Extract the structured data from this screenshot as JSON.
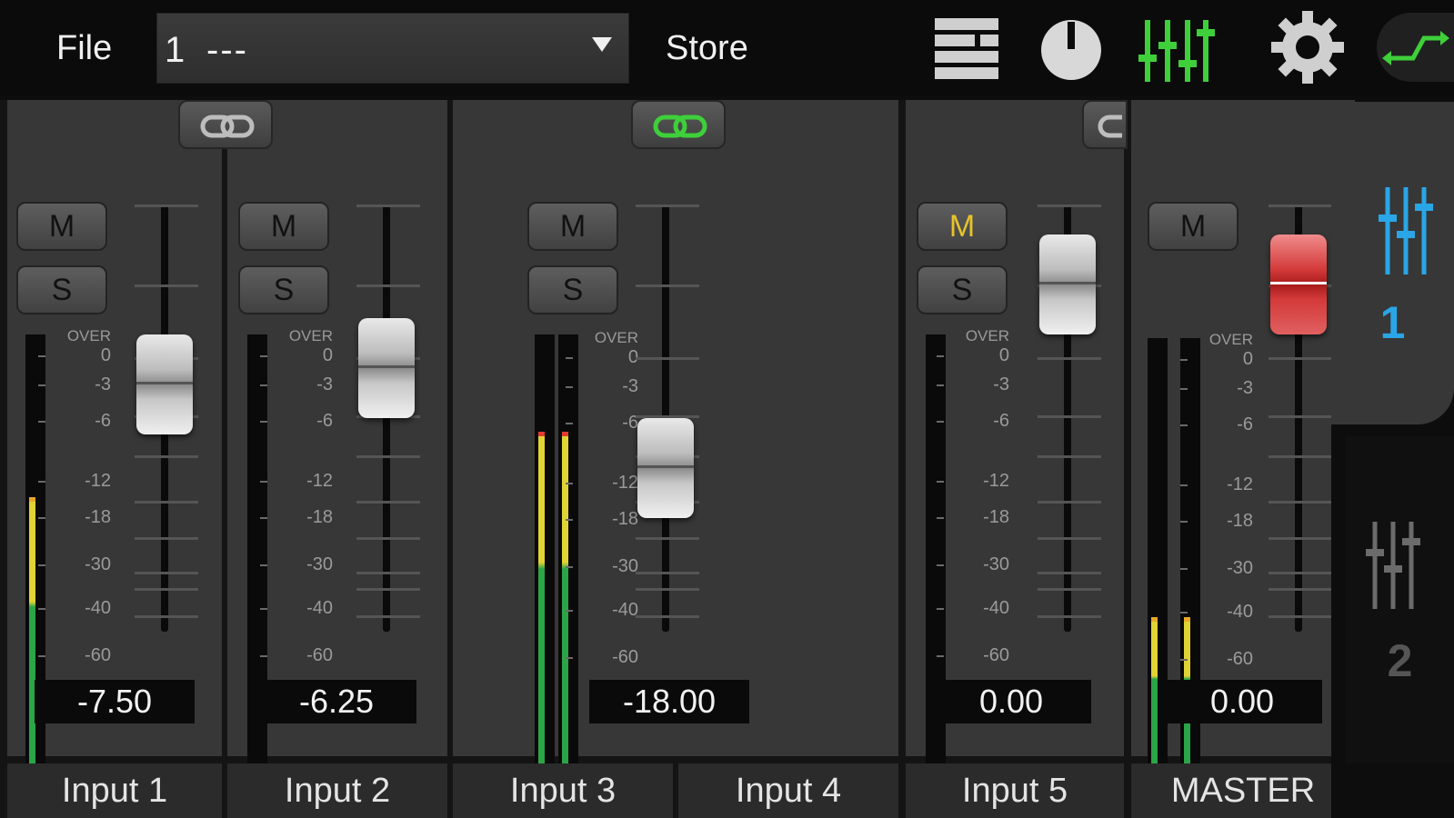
{
  "topbar": {
    "file_label": "File",
    "preset_number": "1",
    "preset_name": "---",
    "store_label": "Store"
  },
  "colors": {
    "accent_green": "#3ecf3a",
    "accent_blue": "#2aa6e6",
    "mute_active": "#e6c32b",
    "master_fader": "#cc2a2a"
  },
  "channels": [
    {
      "name": "Input 1",
      "value": "-7.50",
      "mute_label": "M",
      "solo_label": "S",
      "mute_active": false
    },
    {
      "name": "Input 2",
      "value": "-6.25",
      "mute_label": "M",
      "solo_label": "S",
      "mute_active": false
    },
    {
      "name": "Input 3",
      "value": "-18.00",
      "mute_label": "M",
      "solo_label": "S",
      "mute_active": false
    },
    {
      "name": "Input 4"
    },
    {
      "name": "Input 5",
      "value": "0.00",
      "mute_label": "M",
      "solo_label": "S",
      "mute_active": true
    },
    {
      "name": "MASTER",
      "value": "0.00",
      "mute_label": "M"
    }
  ],
  "meter_scale": [
    "OVER",
    "0",
    "-3",
    "-6",
    "-12",
    "-18",
    "-30",
    "-40",
    "-60"
  ],
  "banks": [
    {
      "number": "1",
      "active": true
    },
    {
      "number": "2",
      "active": false
    }
  ]
}
